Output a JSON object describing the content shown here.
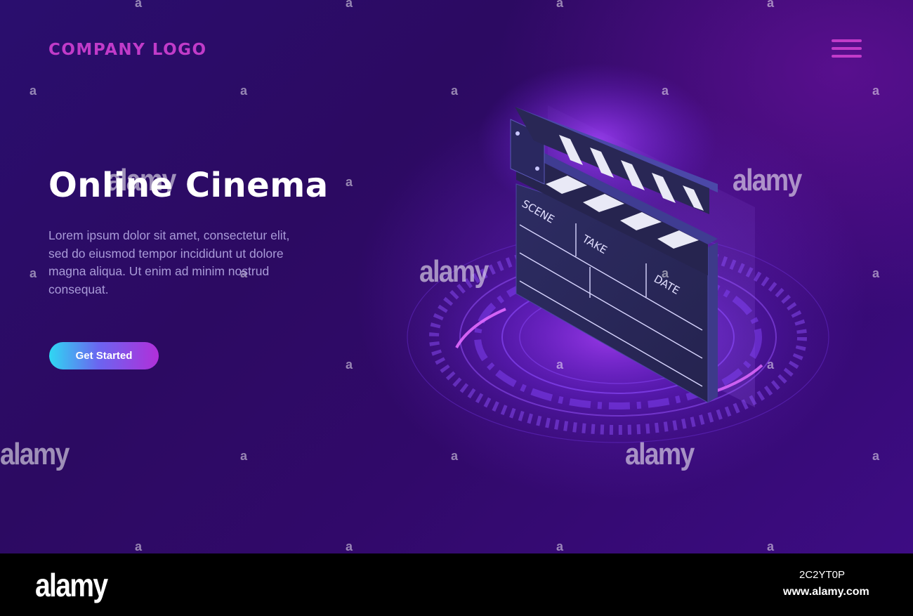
{
  "header": {
    "logo_text": "COMPANY LOGO",
    "menu_icon": "hamburger-menu-icon"
  },
  "hero": {
    "title": "Online Cinema",
    "description": "Lorem ipsum dolor sit amet, consectetur elit, sed do eiusmod tempor incididunt ut dolore magna aliqua. Ut enim ad minim nostrud consequat.",
    "cta_label": "Get Started"
  },
  "clapperboard": {
    "icon": "clapperboard-icon",
    "fields": [
      "SCENE",
      "TAKE",
      "DATE"
    ]
  },
  "watermark": {
    "text": "alamy",
    "letter": "a"
  },
  "footer": {
    "logo_text": "alamy",
    "image_id": "2C2YT0P",
    "url": "www.alamy.com"
  },
  "colors": {
    "accent": "#c13bc9",
    "background": "#2c0a62",
    "button_gradient_start": "#2fd7f2",
    "button_gradient_end": "#b12fd9"
  }
}
